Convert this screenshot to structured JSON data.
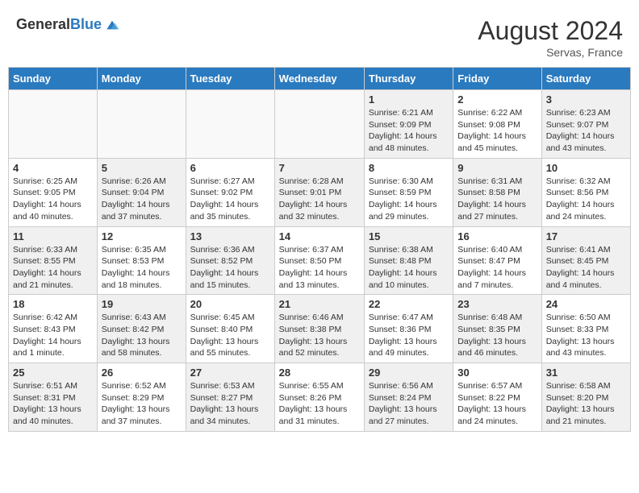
{
  "header": {
    "logo_general": "General",
    "logo_blue": "Blue",
    "month_year": "August 2024",
    "location": "Servas, France"
  },
  "days_of_week": [
    "Sunday",
    "Monday",
    "Tuesday",
    "Wednesday",
    "Thursday",
    "Friday",
    "Saturday"
  ],
  "weeks": [
    [
      {
        "day": "",
        "info": ""
      },
      {
        "day": "",
        "info": ""
      },
      {
        "day": "",
        "info": ""
      },
      {
        "day": "",
        "info": ""
      },
      {
        "day": "1",
        "info": "Sunrise: 6:21 AM\nSunset: 9:09 PM\nDaylight: 14 hours\nand 48 minutes."
      },
      {
        "day": "2",
        "info": "Sunrise: 6:22 AM\nSunset: 9:08 PM\nDaylight: 14 hours\nand 45 minutes."
      },
      {
        "day": "3",
        "info": "Sunrise: 6:23 AM\nSunset: 9:07 PM\nDaylight: 14 hours\nand 43 minutes."
      }
    ],
    [
      {
        "day": "4",
        "info": "Sunrise: 6:25 AM\nSunset: 9:05 PM\nDaylight: 14 hours\nand 40 minutes."
      },
      {
        "day": "5",
        "info": "Sunrise: 6:26 AM\nSunset: 9:04 PM\nDaylight: 14 hours\nand 37 minutes."
      },
      {
        "day": "6",
        "info": "Sunrise: 6:27 AM\nSunset: 9:02 PM\nDaylight: 14 hours\nand 35 minutes."
      },
      {
        "day": "7",
        "info": "Sunrise: 6:28 AM\nSunset: 9:01 PM\nDaylight: 14 hours\nand 32 minutes."
      },
      {
        "day": "8",
        "info": "Sunrise: 6:30 AM\nSunset: 8:59 PM\nDaylight: 14 hours\nand 29 minutes."
      },
      {
        "day": "9",
        "info": "Sunrise: 6:31 AM\nSunset: 8:58 PM\nDaylight: 14 hours\nand 27 minutes."
      },
      {
        "day": "10",
        "info": "Sunrise: 6:32 AM\nSunset: 8:56 PM\nDaylight: 14 hours\nand 24 minutes."
      }
    ],
    [
      {
        "day": "11",
        "info": "Sunrise: 6:33 AM\nSunset: 8:55 PM\nDaylight: 14 hours\nand 21 minutes."
      },
      {
        "day": "12",
        "info": "Sunrise: 6:35 AM\nSunset: 8:53 PM\nDaylight: 14 hours\nand 18 minutes."
      },
      {
        "day": "13",
        "info": "Sunrise: 6:36 AM\nSunset: 8:52 PM\nDaylight: 14 hours\nand 15 minutes."
      },
      {
        "day": "14",
        "info": "Sunrise: 6:37 AM\nSunset: 8:50 PM\nDaylight: 14 hours\nand 13 minutes."
      },
      {
        "day": "15",
        "info": "Sunrise: 6:38 AM\nSunset: 8:48 PM\nDaylight: 14 hours\nand 10 minutes."
      },
      {
        "day": "16",
        "info": "Sunrise: 6:40 AM\nSunset: 8:47 PM\nDaylight: 14 hours\nand 7 minutes."
      },
      {
        "day": "17",
        "info": "Sunrise: 6:41 AM\nSunset: 8:45 PM\nDaylight: 14 hours\nand 4 minutes."
      }
    ],
    [
      {
        "day": "18",
        "info": "Sunrise: 6:42 AM\nSunset: 8:43 PM\nDaylight: 14 hours\nand 1 minute."
      },
      {
        "day": "19",
        "info": "Sunrise: 6:43 AM\nSunset: 8:42 PM\nDaylight: 13 hours\nand 58 minutes."
      },
      {
        "day": "20",
        "info": "Sunrise: 6:45 AM\nSunset: 8:40 PM\nDaylight: 13 hours\nand 55 minutes."
      },
      {
        "day": "21",
        "info": "Sunrise: 6:46 AM\nSunset: 8:38 PM\nDaylight: 13 hours\nand 52 minutes."
      },
      {
        "day": "22",
        "info": "Sunrise: 6:47 AM\nSunset: 8:36 PM\nDaylight: 13 hours\nand 49 minutes."
      },
      {
        "day": "23",
        "info": "Sunrise: 6:48 AM\nSunset: 8:35 PM\nDaylight: 13 hours\nand 46 minutes."
      },
      {
        "day": "24",
        "info": "Sunrise: 6:50 AM\nSunset: 8:33 PM\nDaylight: 13 hours\nand 43 minutes."
      }
    ],
    [
      {
        "day": "25",
        "info": "Sunrise: 6:51 AM\nSunset: 8:31 PM\nDaylight: 13 hours\nand 40 minutes."
      },
      {
        "day": "26",
        "info": "Sunrise: 6:52 AM\nSunset: 8:29 PM\nDaylight: 13 hours\nand 37 minutes."
      },
      {
        "day": "27",
        "info": "Sunrise: 6:53 AM\nSunset: 8:27 PM\nDaylight: 13 hours\nand 34 minutes."
      },
      {
        "day": "28",
        "info": "Sunrise: 6:55 AM\nSunset: 8:26 PM\nDaylight: 13 hours\nand 31 minutes."
      },
      {
        "day": "29",
        "info": "Sunrise: 6:56 AM\nSunset: 8:24 PM\nDaylight: 13 hours\nand 27 minutes."
      },
      {
        "day": "30",
        "info": "Sunrise: 6:57 AM\nSunset: 8:22 PM\nDaylight: 13 hours\nand 24 minutes."
      },
      {
        "day": "31",
        "info": "Sunrise: 6:58 AM\nSunset: 8:20 PM\nDaylight: 13 hours\nand 21 minutes."
      }
    ]
  ]
}
